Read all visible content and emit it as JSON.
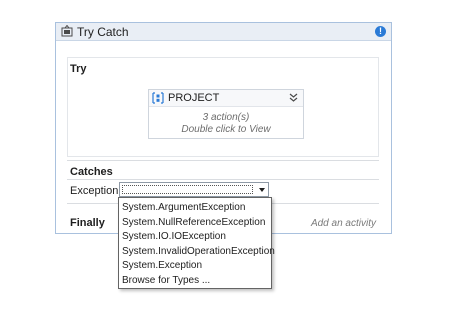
{
  "activity": {
    "title": "Try Catch",
    "icon": "try-catch-icon",
    "info_icon": "info-icon",
    "info_symbol": "!"
  },
  "try_section": {
    "label": "Try",
    "project": {
      "title": "PROJECT",
      "icon": "sequence-icon",
      "collapse_icon": "double-chevron-down-icon",
      "actions_text": "3 action(s)",
      "hint_text": "Double click to View"
    }
  },
  "catches_section": {
    "label": "Catches",
    "exception_label": "Exception",
    "combo_value": "",
    "dropdown_options": [
      "System.ArgumentException",
      "System.NullReferenceException",
      "System.IO.IOException",
      "System.InvalidOperationException",
      "System.Exception",
      "Browse for Types ..."
    ]
  },
  "finally_section": {
    "label": "Finally",
    "add_activity_hint": "Add an activity"
  },
  "colors": {
    "header_bg": "#e9eef5",
    "border": "#a9c1de",
    "info_blue": "#2a7ad6"
  }
}
